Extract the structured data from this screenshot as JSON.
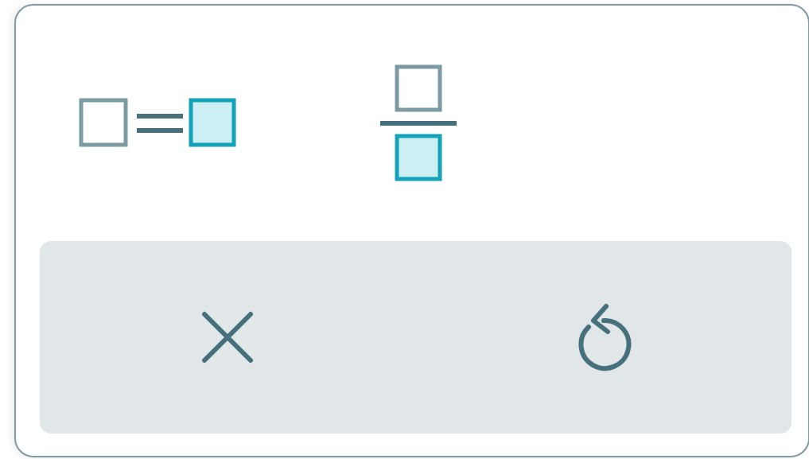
{
  "templates": [
    {
      "kind": "equation"
    },
    {
      "kind": "fraction"
    }
  ],
  "actions": [
    {
      "kind": "close"
    },
    {
      "kind": "reset"
    }
  ]
}
